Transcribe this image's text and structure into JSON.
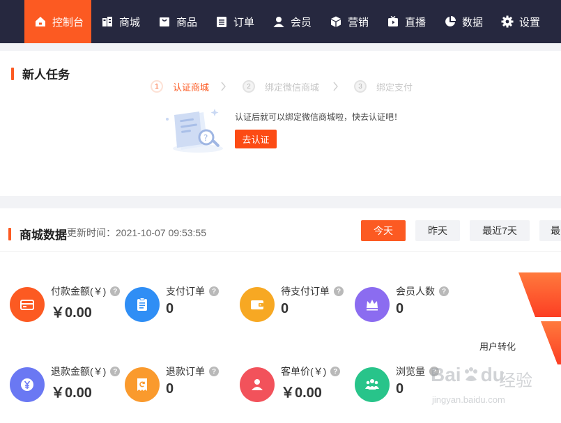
{
  "nav": {
    "items": [
      {
        "label": "控制台",
        "icon": "home-icon"
      },
      {
        "label": "商城",
        "icon": "store-icon"
      },
      {
        "label": "商品",
        "icon": "bag-icon"
      },
      {
        "label": "订单",
        "icon": "list-icon"
      },
      {
        "label": "会员",
        "icon": "user-icon"
      },
      {
        "label": "营销",
        "icon": "cube-icon"
      },
      {
        "label": "直播",
        "icon": "live-icon"
      },
      {
        "label": "数据",
        "icon": "pie-chart-icon"
      },
      {
        "label": "设置",
        "icon": "gear-icon"
      }
    ],
    "active_index": 0,
    "accent": "#fc5a22",
    "background": "#26283f"
  },
  "task": {
    "title": "新人任务",
    "steps": [
      {
        "num": "1",
        "label": "认证商城",
        "active": true
      },
      {
        "num": "2",
        "label": "绑定微信商城",
        "active": false
      },
      {
        "num": "3",
        "label": "绑定支付",
        "active": false
      }
    ],
    "hint": "认证后就可以绑定微信商城啦，快去认证吧！",
    "button_label": "去认证"
  },
  "data": {
    "title": "商城数据",
    "update_label": "更新时间：",
    "update_time": "2021-10-07 09:53:55",
    "tabs": [
      {
        "label": "今天",
        "active": true
      },
      {
        "label": "昨天",
        "active": false
      },
      {
        "label": "最近7天",
        "active": false
      },
      {
        "label": "最",
        "active": false
      }
    ],
    "stats": [
      {
        "label": "付款金额(￥)",
        "value": "￥0.00",
        "icon": "card-icon",
        "color": "#fc5a22"
      },
      {
        "label": "支付订单",
        "value": "0",
        "icon": "clipboard-icon",
        "color": "#2f8ef5"
      },
      {
        "label": "待支付订单",
        "value": "0",
        "icon": "wallet-icon",
        "color": "#f7a823"
      },
      {
        "label": "会员人数",
        "value": "0",
        "icon": "crown-icon",
        "color": "#8b6cf0"
      },
      {
        "label": "退款金额(￥)",
        "value": "￥0.00",
        "icon": "yen-coin-icon",
        "color": "#6a78f3"
      },
      {
        "label": "退款订单",
        "value": "0",
        "icon": "refund-receipt-icon",
        "color": "#fa9a2d"
      },
      {
        "label": "客单价(￥)",
        "value": "￥0.00",
        "icon": "person-icon",
        "color": "#f2525b"
      },
      {
        "label": "浏览量",
        "value": "0",
        "icon": "group-icon",
        "color": "#28c48a"
      }
    ],
    "funnel_label": "用户转化"
  },
  "watermark": {
    "brand_a": "Bai",
    "brand_b": "du",
    "cn": "经验",
    "url": "jingyan.baidu.com"
  }
}
